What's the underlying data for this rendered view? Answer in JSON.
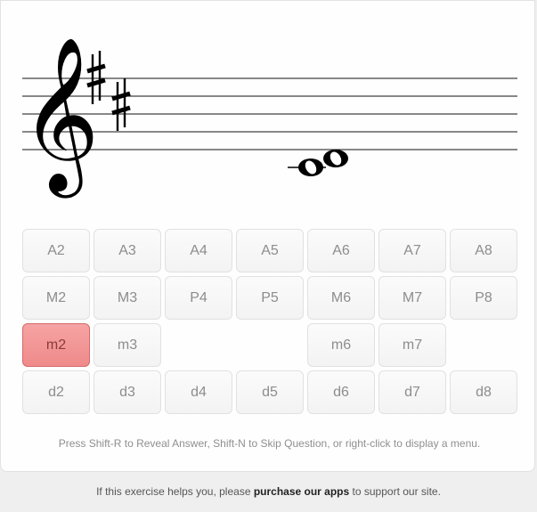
{
  "staff": {
    "clef": "treble-clef",
    "key_signature": [
      "F-sharp",
      "C-sharp"
    ],
    "notes": [
      "C4",
      "D4"
    ]
  },
  "buttons": {
    "row1": [
      {
        "label": "A2",
        "state": "normal"
      },
      {
        "label": "A3",
        "state": "normal"
      },
      {
        "label": "A4",
        "state": "normal"
      },
      {
        "label": "A5",
        "state": "normal"
      },
      {
        "label": "A6",
        "state": "normal"
      },
      {
        "label": "A7",
        "state": "normal"
      },
      {
        "label": "A8",
        "state": "normal"
      }
    ],
    "row2": [
      {
        "label": "M2",
        "state": "normal"
      },
      {
        "label": "M3",
        "state": "normal"
      },
      {
        "label": "P4",
        "state": "normal"
      },
      {
        "label": "P5",
        "state": "normal"
      },
      {
        "label": "M6",
        "state": "normal"
      },
      {
        "label": "M7",
        "state": "normal"
      },
      {
        "label": "P8",
        "state": "normal"
      }
    ],
    "row3": [
      {
        "label": "m2",
        "state": "wrong"
      },
      {
        "label": "m3",
        "state": "normal"
      },
      {
        "label": "m6",
        "state": "normal"
      },
      {
        "label": "m7",
        "state": "normal"
      }
    ],
    "row4": [
      {
        "label": "d2",
        "state": "normal"
      },
      {
        "label": "d3",
        "state": "normal"
      },
      {
        "label": "d4",
        "state": "normal"
      },
      {
        "label": "d5",
        "state": "normal"
      },
      {
        "label": "d6",
        "state": "normal"
      },
      {
        "label": "d7",
        "state": "normal"
      },
      {
        "label": "d8",
        "state": "normal"
      }
    ]
  },
  "colors": {
    "wrong": "#ef8a8a"
  },
  "hint": "Press Shift-R to Reveal Answer, Shift-N to Skip Question, or right-click to display a menu.",
  "footer": {
    "before": "If this exercise helps you, please ",
    "link": "purchase our apps",
    "after": " to support our site."
  }
}
